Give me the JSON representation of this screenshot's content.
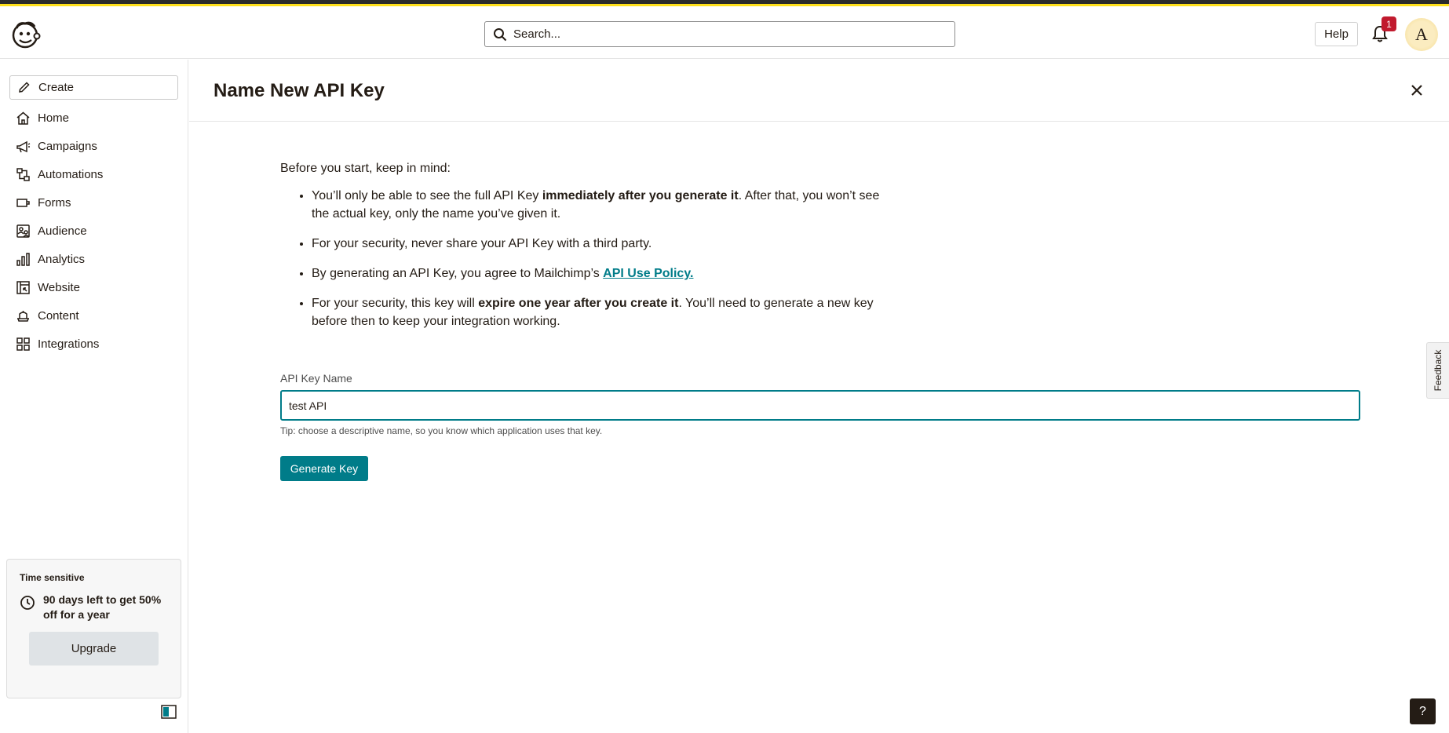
{
  "topbar": {
    "search_placeholder": "Search...",
    "help_label": "Help",
    "notification_count": "1",
    "avatar_initial": "A"
  },
  "sidebar": {
    "create_label": "Create",
    "items": [
      {
        "label": "Home",
        "icon": "home-icon"
      },
      {
        "label": "Campaigns",
        "icon": "megaphone-icon"
      },
      {
        "label": "Automations",
        "icon": "automations-icon"
      },
      {
        "label": "Forms",
        "icon": "forms-icon"
      },
      {
        "label": "Audience",
        "icon": "audience-icon"
      },
      {
        "label": "Analytics",
        "icon": "analytics-icon"
      },
      {
        "label": "Website",
        "icon": "website-icon"
      },
      {
        "label": "Content",
        "icon": "content-icon"
      },
      {
        "label": "Integrations",
        "icon": "integrations-icon"
      }
    ],
    "promo": {
      "eyebrow": "Time sensitive",
      "message": "90 days left to get 50% off for a year",
      "button_label": "Upgrade"
    }
  },
  "main": {
    "title": "Name New API Key",
    "intro": "Before you start, keep in mind:",
    "bullets": {
      "b1_pre": "You’ll only be able to see the full API Key ",
      "b1_bold": "immediately after you generate it",
      "b1_post": ". After that, you won’t see the actual key, only the name you’ve given it.",
      "b2": "For your security, never share your API Key with a third party.",
      "b3_pre": "By generating an API Key, you agree to Mailchimp’s ",
      "b3_link": "API Use Policy.",
      "b4_pre": "For your security, this key will ",
      "b4_bold": "expire one year after you create it",
      "b4_post": ". You’ll need to generate a new key before then to keep your integration working."
    },
    "field_label": "API Key Name",
    "field_value": "test API",
    "tip": "Tip: choose a descriptive name, so you know which application uses that key.",
    "generate_label": "Generate Key"
  },
  "feedback_label": "Feedback",
  "help_fab": "?",
  "colors": {
    "accent": "#007c89",
    "brand_yellow": "#ffe01b",
    "badge_red": "#c11a2e"
  }
}
